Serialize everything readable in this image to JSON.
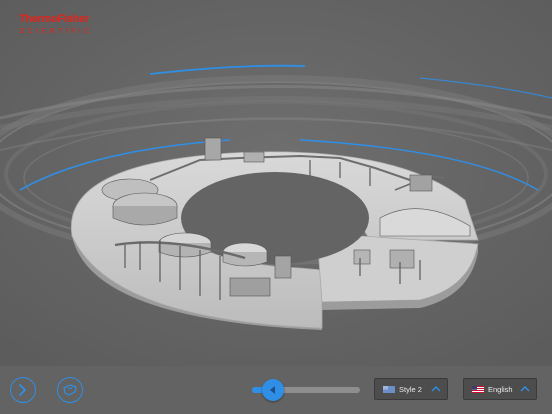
{
  "brand": {
    "name": "ThermoFisher",
    "tagline": "SCIENTIFIC",
    "color": "#e2231a"
  },
  "scene": {
    "description_icon": "circular-processing-plant-3d-model",
    "background_color": "#646464",
    "accent_color": "#2f8fe6"
  },
  "toolbar": {
    "next_icon": "chevron-right-icon",
    "tour_icon": "hand-pointer-icon",
    "slider_value": 0.12,
    "slider_icon": "play-triangle-icon",
    "style_select": {
      "selected": "Style 2",
      "icon": "style-swatch-icon"
    },
    "language_select": {
      "selected": "English",
      "icon": "us-flag-icon"
    }
  }
}
